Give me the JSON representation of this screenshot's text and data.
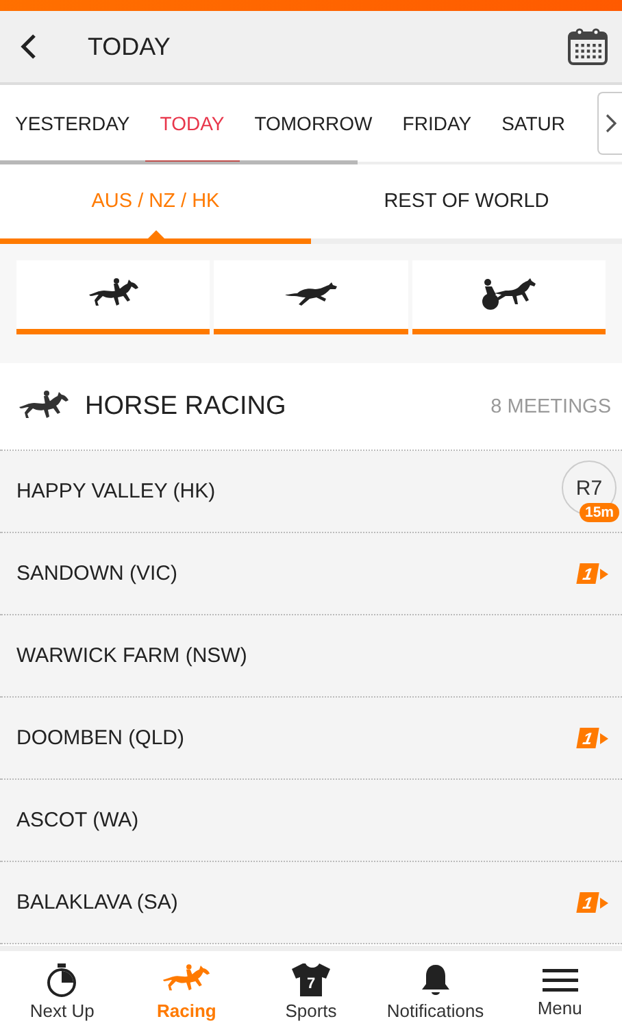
{
  "header": {
    "title": "TODAY"
  },
  "date_tabs": [
    {
      "label": "YESTERDAY",
      "selected": false
    },
    {
      "label": "TODAY",
      "selected": true
    },
    {
      "label": "TOMORROW",
      "selected": false
    },
    {
      "label": "FRIDAY",
      "selected": false
    },
    {
      "label": "SATUR",
      "selected": false
    }
  ],
  "region_tabs": [
    {
      "label": "AUS / NZ / HK",
      "selected": true
    },
    {
      "label": "REST OF WORLD",
      "selected": false
    }
  ],
  "sport_tabs": [
    {
      "kind": "horse"
    },
    {
      "kind": "greyhound"
    },
    {
      "kind": "harness"
    }
  ],
  "section": {
    "title": "HORSE RACING",
    "count": "8 MEETINGS"
  },
  "meetings": [
    {
      "name": "HAPPY VALLEY (HK)",
      "kind": "next_race",
      "race": "R7",
      "time": "15m"
    },
    {
      "name": "SANDOWN (VIC)",
      "kind": "badge",
      "badge": "1"
    },
    {
      "name": "WARWICK FARM (NSW)",
      "kind": "plain"
    },
    {
      "name": "DOOMBEN (QLD)",
      "kind": "badge",
      "badge": "1"
    },
    {
      "name": "ASCOT (WA)",
      "kind": "plain"
    },
    {
      "name": "BALAKLAVA (SA)",
      "kind": "badge",
      "badge": "1"
    }
  ],
  "bottom_nav": [
    {
      "label": "Next Up",
      "selected": false
    },
    {
      "label": "Racing",
      "selected": true
    },
    {
      "label": "Sports",
      "icon_text": "7",
      "selected": false
    },
    {
      "label": "Notifications",
      "selected": false
    },
    {
      "label": "Menu",
      "selected": false
    }
  ]
}
